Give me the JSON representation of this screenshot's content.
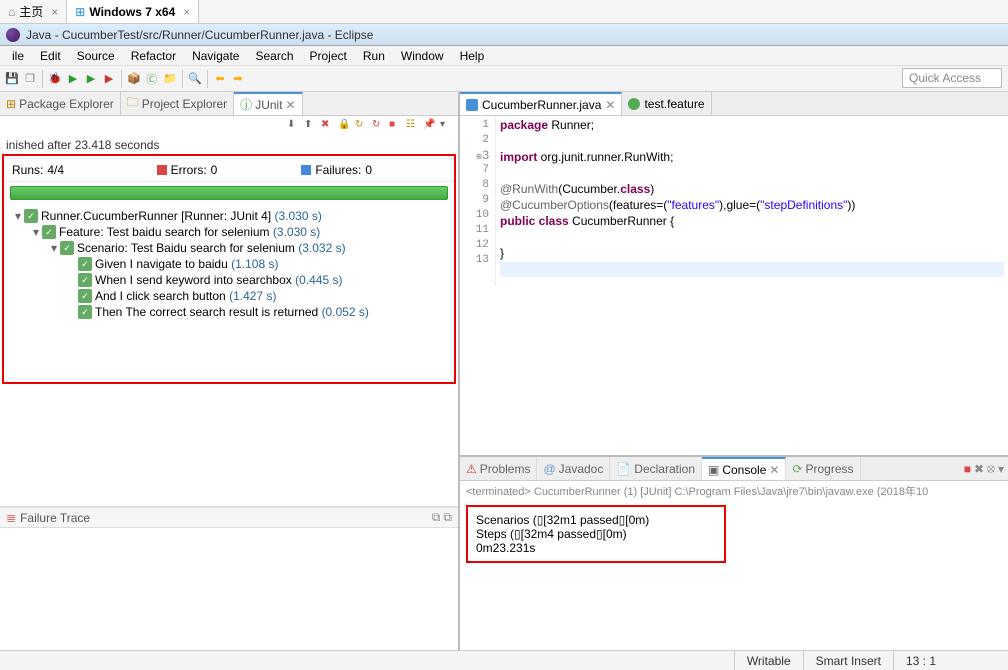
{
  "browser": {
    "tab1": "主页",
    "tab2": "Windows 7 x64"
  },
  "window_title": "Java - CucumberTest/src/Runner/CucumberRunner.java - Eclipse",
  "menu": [
    "ile",
    "Edit",
    "Source",
    "Refactor",
    "Navigate",
    "Search",
    "Project",
    "Run",
    "Window",
    "Help"
  ],
  "quick_access_placeholder": "Quick Access",
  "left_views": {
    "package_explorer": "Package Explorer",
    "project_explorer": "Project Explorer",
    "junit": "JUnit"
  },
  "junit": {
    "finish_text": "inished after 23.418 seconds",
    "runs_label": "Runs:",
    "runs_value": "4/4",
    "errors_label": "Errors:",
    "errors_value": "0",
    "failures_label": "Failures:",
    "failures_value": "0",
    "tree": {
      "root": "Runner.CucumberRunner [Runner: JUnit 4]",
      "root_time": "(3.030 s)",
      "feature": "Feature: Test baidu search for selenium",
      "feature_time": "(3.030 s)",
      "scenario": "Scenario: Test Baidu search for selenium",
      "scenario_time": "(3.032 s)",
      "step1": "Given I navigate to baidu",
      "step1_time": "(1.108 s)",
      "step2": "When I send keyword into searchbox",
      "step2_time": "(0.445 s)",
      "step3": "And I click search button",
      "step3_time": "(1.427 s)",
      "step4": "Then The correct search result is returned",
      "step4_time": "(0.052 s)"
    },
    "failure_trace_label": "Failure Trace"
  },
  "editor": {
    "tab1": "CucumberRunner.java",
    "tab2": "test.feature",
    "lines": [
      "1",
      "2",
      "3",
      "7",
      "8",
      "9",
      "10",
      "11",
      "12",
      "13"
    ],
    "src_line1a": "package",
    "src_line1b": " Runner;",
    "src_line3a": "import",
    "src_line3b": " org.junit.runner.RunWith;",
    "src_line8a": "@RunWith",
    "src_line8b": "(Cucumber.",
    "src_line8c": "class",
    "src_line8d": ")",
    "src_line9a": "@CucumberOptions",
    "src_line9b": "(features=(",
    "src_line9c": "\"features\"",
    "src_line9d": "),glue=(",
    "src_line9e": "\"stepDefinitions\"",
    "src_line9f": "))",
    "src_line10a": "public class",
    "src_line10b": " CucumberRunner {",
    "src_line12": "}"
  },
  "bottom_views": {
    "problems": "Problems",
    "javadoc": "Javadoc",
    "declaration": "Declaration",
    "console": "Console",
    "progress": "Progress"
  },
  "console": {
    "header": "<terminated> CucumberRunner (1) [JUnit] C:\\Program Files\\Java\\jre7\\bin\\javaw.exe (2018年10",
    "line1": " Scenarios (▯[32m1 passed▯[0m)",
    "line2": " Steps (▯[32m4 passed▯[0m)",
    "line3": "0m23.231s"
  },
  "statusbar": {
    "writable": "Writable",
    "insert": "Smart Insert",
    "pos": "13 : 1"
  }
}
